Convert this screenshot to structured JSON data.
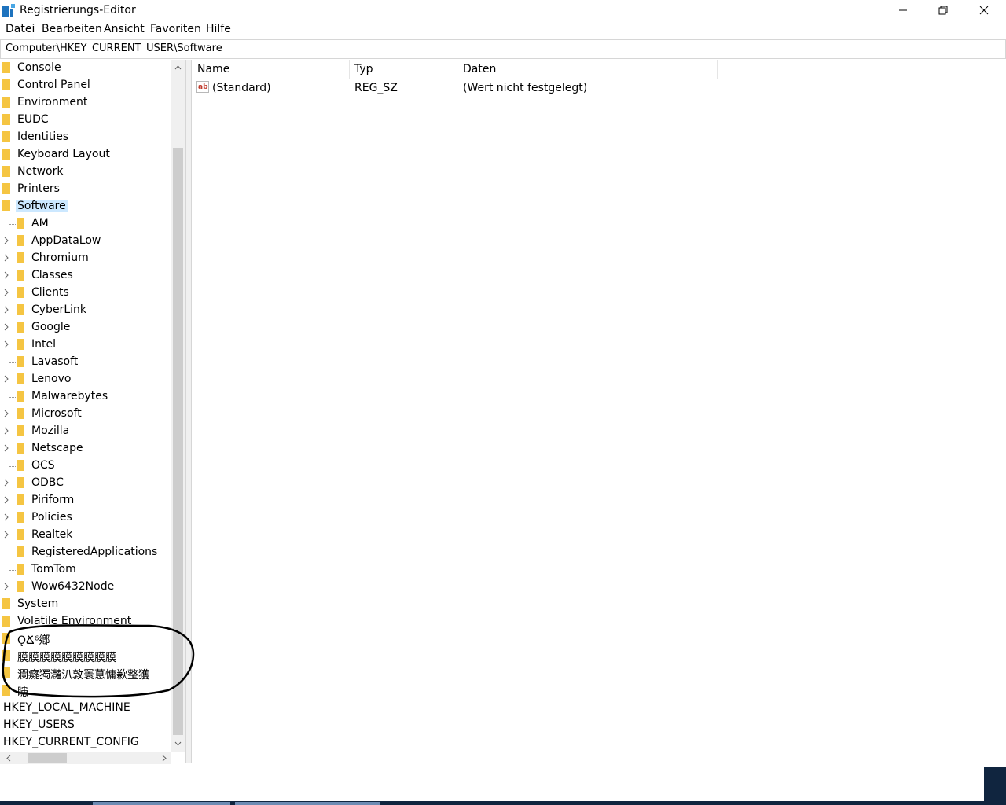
{
  "window": {
    "title": "Registrierungs-Editor"
  },
  "menu": [
    "Datei",
    "Bearbeiten",
    "Ansicht",
    "Favoriten",
    "Hilfe"
  ],
  "address": "Computer\\HKEY_CURRENT_USER\\Software",
  "tree": {
    "top_items": [
      "Console",
      "Control Panel",
      "Environment",
      "EUDC",
      "Identities",
      "Keyboard Layout",
      "Network",
      "Printers"
    ],
    "selected": "Software",
    "software_children": [
      {
        "label": "AM",
        "expandable": false
      },
      {
        "label": "AppDataLow",
        "expandable": true
      },
      {
        "label": "Chromium",
        "expandable": true
      },
      {
        "label": "Classes",
        "expandable": true
      },
      {
        "label": "Clients",
        "expandable": true
      },
      {
        "label": "CyberLink",
        "expandable": true
      },
      {
        "label": "Google",
        "expandable": true
      },
      {
        "label": "Intel",
        "expandable": true
      },
      {
        "label": "Lavasoft",
        "expandable": false
      },
      {
        "label": "Lenovo",
        "expandable": true
      },
      {
        "label": "Malwarebytes",
        "expandable": false
      },
      {
        "label": "Microsoft",
        "expandable": true
      },
      {
        "label": "Mozilla",
        "expandable": true
      },
      {
        "label": "Netscape",
        "expandable": true
      },
      {
        "label": "OCS",
        "expandable": false
      },
      {
        "label": "ODBC",
        "expandable": true
      },
      {
        "label": "Piriform",
        "expandable": true
      },
      {
        "label": "Policies",
        "expandable": true
      },
      {
        "label": "Realtek",
        "expandable": true
      },
      {
        "label": "RegisteredApplications",
        "expandable": false
      },
      {
        "label": "TomTom",
        "expandable": false
      },
      {
        "label": "Wow6432Node",
        "expandable": true
      }
    ],
    "after_items": [
      "System",
      "Volatile Environment",
      "ǪՃ⁶鄕",
      "膜膜膜膜膜膜膜膜膜",
      "瀾癡獨灩汃敦瞏蒠慵歉整獲",
      "瞣"
    ],
    "roots": [
      "HKEY_LOCAL_MACHINE",
      "HKEY_USERS",
      "HKEY_CURRENT_CONFIG"
    ]
  },
  "list": {
    "columns": [
      "Name",
      "Typ",
      "Daten"
    ],
    "rows": [
      {
        "name": "(Standard)",
        "type": "REG_SZ",
        "data": "(Wert nicht festgelegt)",
        "icon": "string-value-icon"
      }
    ]
  },
  "colors": {
    "folder": "#f5c542",
    "selection": "#cce8ff",
    "taskbar": "#10253f"
  }
}
